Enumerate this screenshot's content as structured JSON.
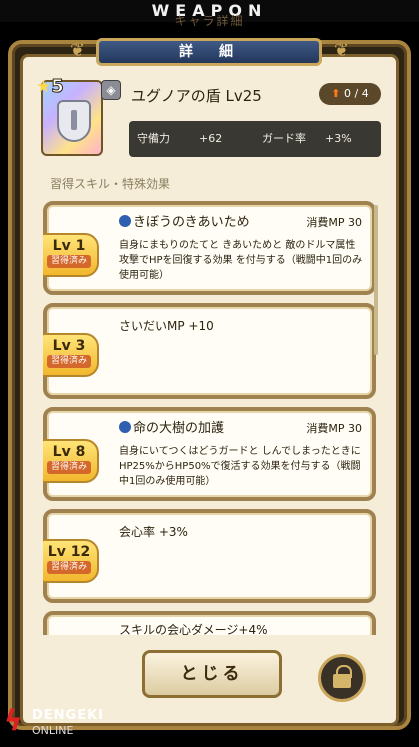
{
  "banner": "WEAPON",
  "ghost_title": "キャラ詳細",
  "panel_title": "詳　細",
  "item": {
    "rarity": "5",
    "name": "ユグノアの盾 Lv25",
    "upgrade": "0 / 4",
    "stats": {
      "def_label": "守備力",
      "def_value": "+62",
      "guard_label": "ガード率",
      "guard_value": "+3%"
    }
  },
  "section_label": "習得スキル・特殊効果",
  "skills": [
    {
      "level": "Lv 1",
      "acquired": "習得済み",
      "title": "きぼうのきあいため",
      "mp": "消費MP 30",
      "desc": "自身にまもりのたてと きあいためと 敵のドルマ属性攻撃でHPを回復する効果 を付与する（戦闘中1回のみ使用可能）"
    },
    {
      "level": "Lv 3",
      "acquired": "習得済み",
      "text": "さいだいMP +10"
    },
    {
      "level": "Lv 8",
      "acquired": "習得済み",
      "title": "命の大樹の加護",
      "mp": "消費MP 30",
      "desc": "自身にいてつくはどうガードと しんでしまったときに HP25%からHP50%で復活する効果を付与する（戦闘中1回のみ使用可能）"
    },
    {
      "level": "Lv 12",
      "acquired": "習得済み",
      "text": "会心率 +3%"
    },
    {
      "text": "スキルの会心ダメージ+4%"
    }
  ],
  "close_label": "とじる",
  "watermark": {
    "brand": "DENGEKI",
    "brand2": "ONLINE"
  }
}
